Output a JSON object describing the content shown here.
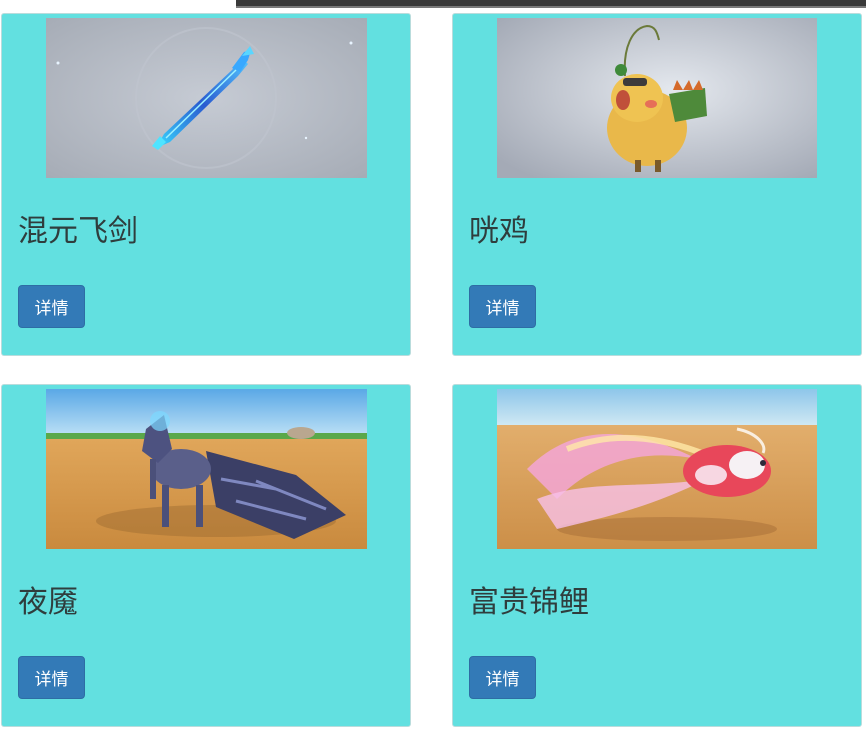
{
  "cards": [
    {
      "title": "混元飞剑",
      "button": "详情",
      "image": "flying-sword-image"
    },
    {
      "title": "咣鸡",
      "button": "详情",
      "image": "chicken-mount-image"
    },
    {
      "title": "夜魇",
      "button": "详情",
      "image": "nightmare-horse-image"
    },
    {
      "title": "富贵锦鲤",
      "button": "详情",
      "image": "koi-fish-image"
    }
  ],
  "colors": {
    "card_bg": "#62e0e0",
    "button_bg": "#337ab7",
    "title_text": "#2f3d3d"
  }
}
